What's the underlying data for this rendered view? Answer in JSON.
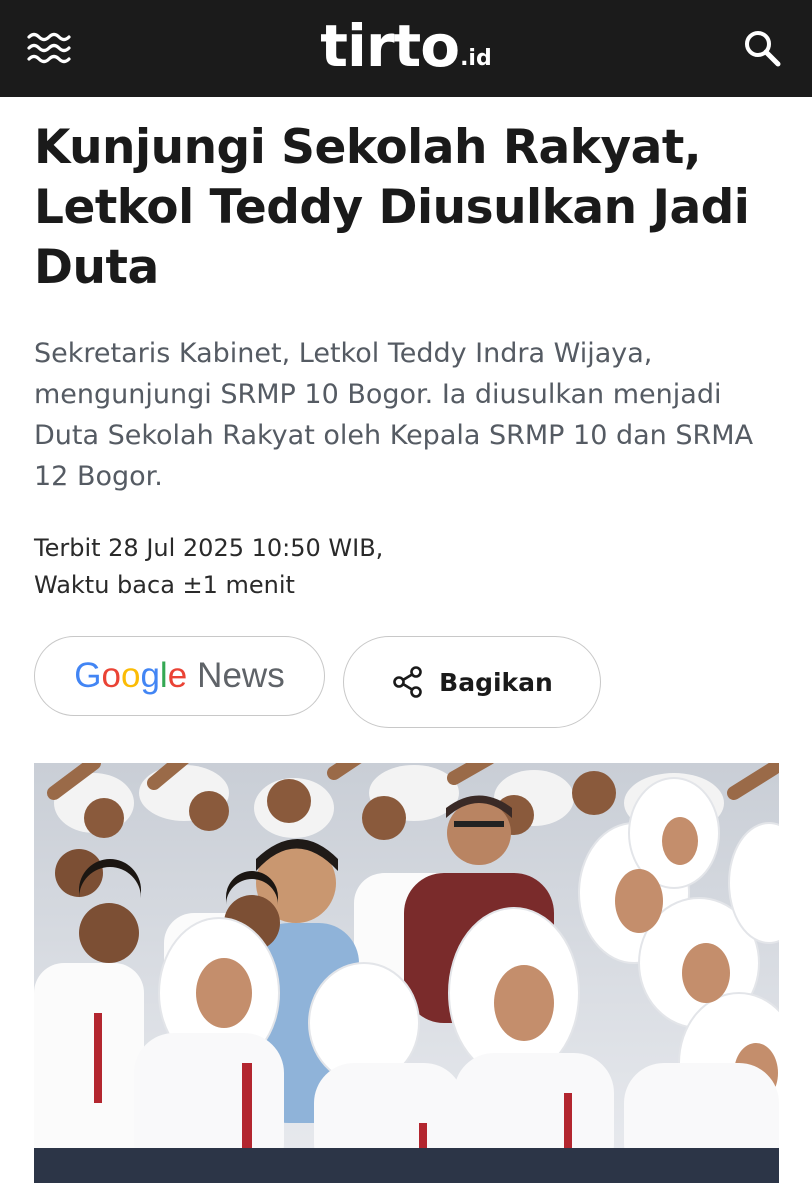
{
  "header": {
    "logo_main": "tirto",
    "logo_suffix": ".id",
    "menu_icon": "menu-waves-icon",
    "search_icon": "search-icon",
    "background": "#1b1b1b"
  },
  "article": {
    "title": "Kunjungi Sekolah Rakyat, Letkol Teddy Diusulkan Jadi Duta",
    "summary": "Sekretaris Kabinet, Letkol Teddy Indra Wijaya, mengunjungi SRMP 10 Bogor. Ia diusulkan menjadi Duta Sekolah Rakyat oleh Kepala SRMP 10 dan SRMA 12 Bogor.",
    "published": "Terbit 28 Jul 2025 10:50 WIB,",
    "read_time": "Waktu baca ±1 menit"
  },
  "actions": {
    "google_letters": [
      "G",
      "o",
      "o",
      "g",
      "l",
      "e"
    ],
    "google_colors": [
      "#4285F4",
      "#EA4335",
      "#FBBC05",
      "#4285F4",
      "#34A853",
      "#EA4335"
    ],
    "news_label": "News",
    "share_label": "Bagikan",
    "share_icon": "share-icon"
  }
}
